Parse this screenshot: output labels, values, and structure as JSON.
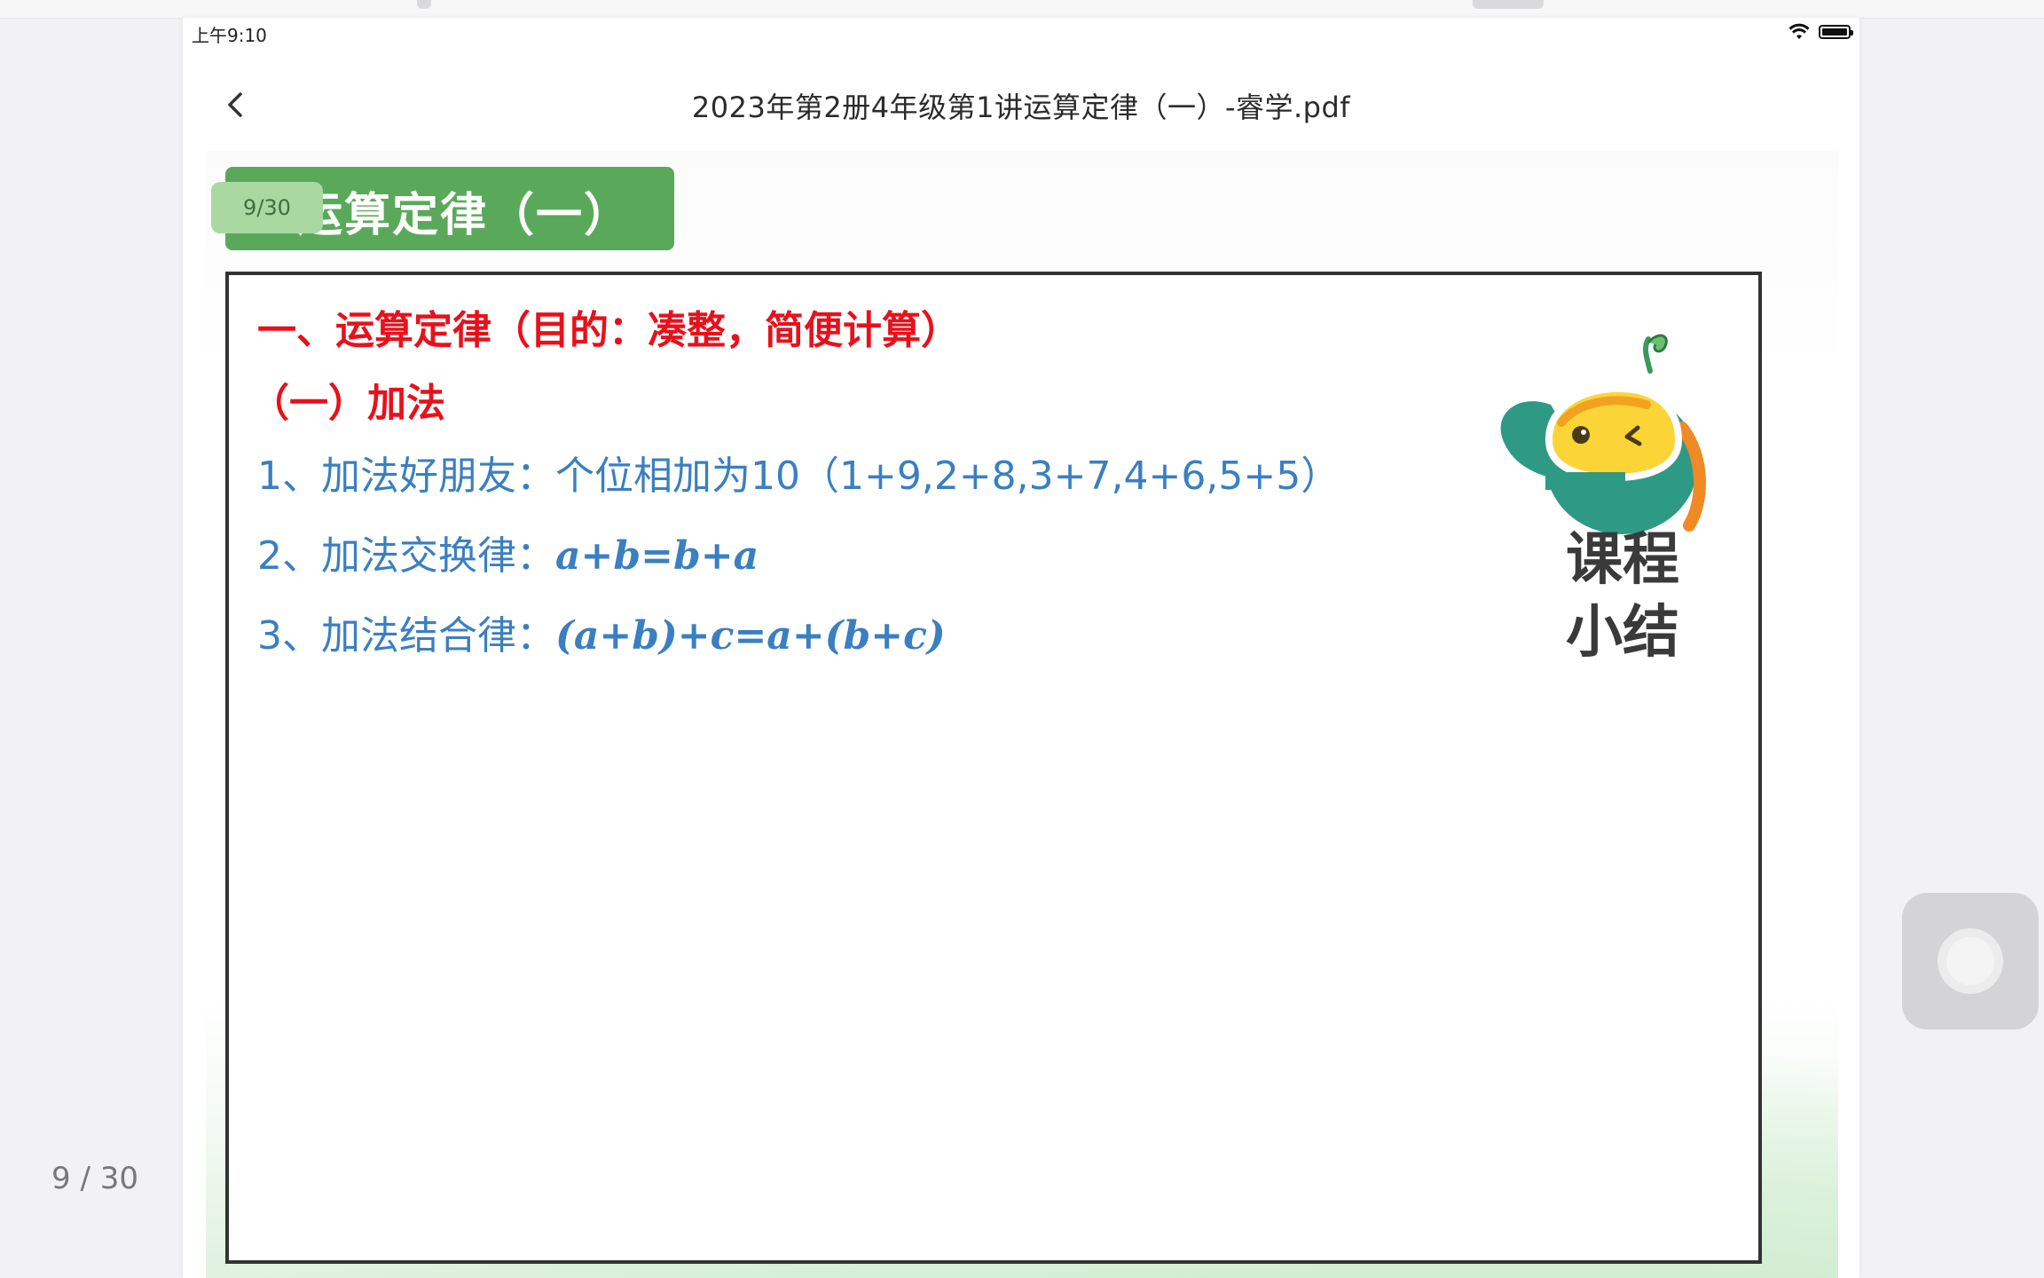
{
  "status_bar": {
    "time": "上午9:10",
    "icons": [
      "wifi-icon",
      "battery-icon"
    ]
  },
  "nav": {
    "back_icon": "chevron-left-icon",
    "title": "2023年第2册4年级第1讲运算定律（一）-睿学.pdf"
  },
  "page": {
    "badge": "9/30",
    "banner_title": "运算定律（一）",
    "heading": "一、运算定律（目的：凑整，简便计算）",
    "subheading": "（一）加法",
    "items": [
      {
        "label": "1、加法好朋友：个位相加为10（1+9,2+8,3+7,4+6,5+5）",
        "formula": ""
      },
      {
        "label": "2、加法交换律：",
        "formula": "a+b=b+a"
      },
      {
        "label": "3、加法结合律：",
        "formula": "(a+b)+c=a+(b+c)"
      }
    ],
    "summary_line1": "课程",
    "summary_line2": "小结"
  },
  "sidebar": {
    "page_indicator": "9 / 30"
  },
  "colors": {
    "banner_green": "#5aa95a",
    "heading_red": "#e8111b",
    "item_blue": "#3a7fc1"
  }
}
